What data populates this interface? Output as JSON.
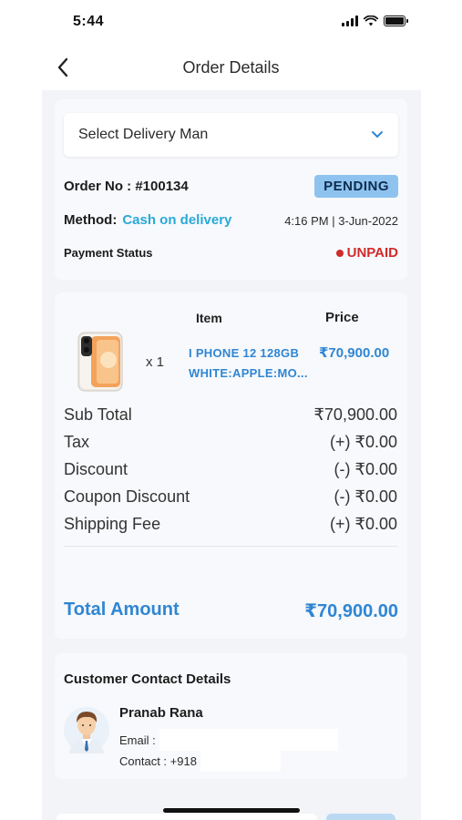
{
  "status_bar": {
    "time": "5:44"
  },
  "header": {
    "title": "Order Details"
  },
  "delivery": {
    "select_label": "Select Delivery Man"
  },
  "order": {
    "number": "Order No : #100134",
    "status": "PENDING",
    "method_label": "Method:",
    "method_value": "Cash on delivery",
    "datetime": "4:16 PM | 3-Jun-2022",
    "payment_status_label": "Payment Status",
    "payment_status_value": "UNPAID"
  },
  "items": {
    "header_item": "Item",
    "header_price": "Price",
    "rows": [
      {
        "qty": "x 1",
        "name_line1": "I PHONE 12 128GB",
        "name_line2": "WHITE:APPLE:MO...",
        "price": "₹70,900.00"
      }
    ]
  },
  "summary": {
    "rows": [
      {
        "label": "Sub Total",
        "value": "₹70,900.00"
      },
      {
        "label": "Tax",
        "value": "(+) ₹0.00"
      },
      {
        "label": "Discount",
        "value": "(-) ₹0.00"
      },
      {
        "label": "Coupon Discount",
        "value": "(-) ₹0.00"
      },
      {
        "label": "Shipping Fee",
        "value": "(+) ₹0.00"
      }
    ],
    "total_label": "Total Amount",
    "total_value": "₹70,900.00"
  },
  "customer": {
    "title": "Customer Contact Details",
    "name": "Pranab Rana",
    "email_label": "Email :",
    "contact_label": "Contact : +918"
  },
  "colors": {
    "accent_blue": "#2f86d3",
    "method_cyan": "#29a9d9",
    "pending_badge": "#8fc3ef",
    "unpaid_red": "#d12a2a",
    "content_bg": "#f2f4f7"
  },
  "icons": {
    "back": "chevron-left-icon",
    "dropdown": "chevron-down-icon",
    "signal": "cellular-signal-icon",
    "wifi": "wifi-icon",
    "battery": "battery-icon"
  }
}
